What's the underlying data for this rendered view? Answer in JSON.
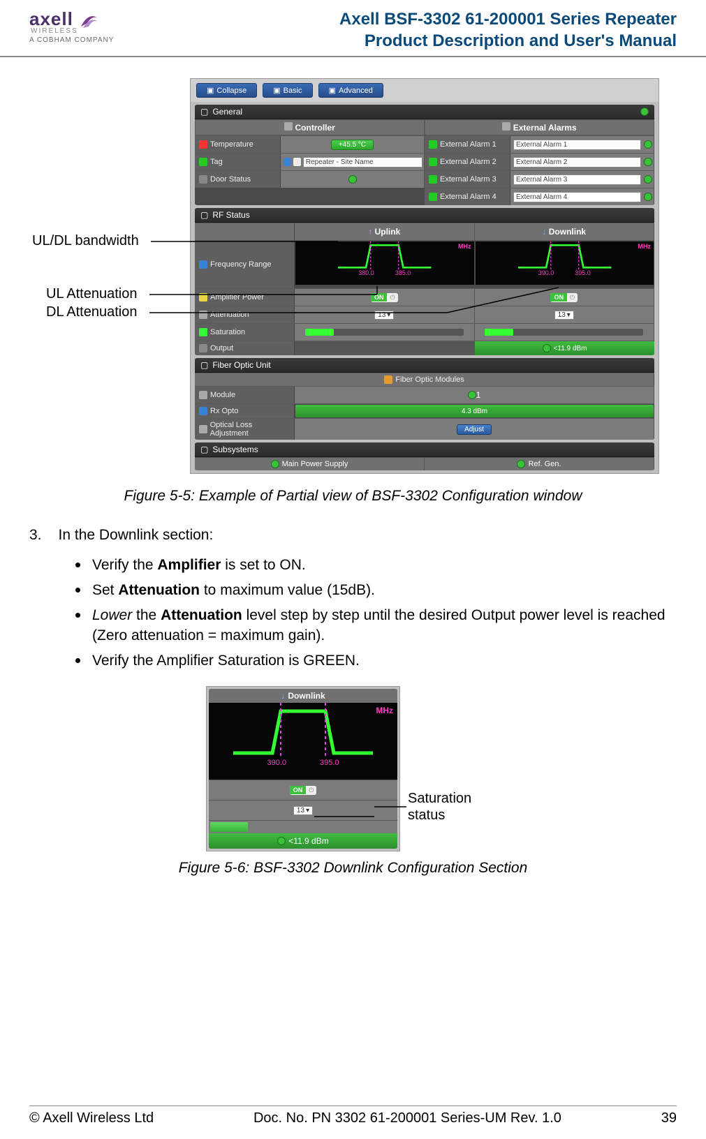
{
  "header": {
    "brand": "axell",
    "brand_sub": "WIRELESS",
    "cobham": "A COBHAM COMPANY",
    "title1": "Axell BSF-3302 61-200001 Series Repeater",
    "title2": "Product Description and User's Manual"
  },
  "toolbar": {
    "collapse": "Collapse",
    "basic": "Basic",
    "advanced": "Advanced"
  },
  "panels": {
    "general": {
      "title": "General",
      "controller": "Controller",
      "ext_alarms": "External Alarms",
      "temperature_label": "Temperature",
      "temperature_value": "+45.5 °C",
      "tag_label": "Tag",
      "tag_value": "Repeater - Site Name",
      "door_label": "Door Status",
      "ext1_label": "External Alarm 1",
      "ext1_value": "External Alarm 1",
      "ext2_label": "External Alarm 2",
      "ext2_value": "External Alarm 2",
      "ext3_label": "External Alarm 3",
      "ext3_value": "External Alarm 3",
      "ext4_label": "External Alarm 4",
      "ext4_value": "External Alarm 4"
    },
    "rf": {
      "title": "RF Status",
      "uplink": "Uplink",
      "downlink": "Downlink",
      "freq_range": "Frequency Range",
      "ul_lo": "380.0",
      "ul_hi": "385.0",
      "dl_lo": "390.0",
      "dl_hi": "395.0",
      "mhz": "MHz",
      "amp_power": "Amplifier Power",
      "attenuation": "Attenuation",
      "atten_val": "13",
      "saturation": "Saturation",
      "output": "Output",
      "output_val": "<11.9 dBm"
    },
    "fiber": {
      "title": "Fiber Optic Unit",
      "modules": "Fiber Optic Modules",
      "module_label": "Module",
      "module_val": "1",
      "rx_label": "Rx Opto",
      "rx_val": "4.3 dBm",
      "adj_label": "Optical Loss Adjustment",
      "adj_btn": "Adjust"
    },
    "sub": {
      "title": "Subsystems",
      "main_ps": "Main Power Supply",
      "ref_gen": "Ref. Gen."
    }
  },
  "callouts": {
    "bw": "UL/DL bandwidth",
    "ul_att": "UL Attenuation",
    "dl_att": "DL Attenuation",
    "sat": "Saturation status"
  },
  "captions": {
    "fig55": "Figure 5-5: Example of Partial view of BSF-3302 Configuration window",
    "fig56": "Figure 5-6: BSF-3302 Downlink Configuration Section"
  },
  "body": {
    "num": "3.",
    "lead": "In the Downlink section:",
    "b1_pre": "Verify the ",
    "b1_bold": "Amplifier",
    "b1_post": " is set to ON.",
    "b2_pre": "Set ",
    "b2_bold": "Attenuation",
    "b2_post": " to maximum value (15dB).",
    "b3_pre_i": "Lower",
    "b3_mid": " the ",
    "b3_bold": "Attenuation",
    "b3_post": " level step by step until the desired Output power level is reached (Zero attenuation = maximum gain).",
    "b4": "Verify the Amplifier Saturation is GREEN."
  },
  "dl_fig": {
    "head": "Downlink",
    "mhz": "MHz",
    "lo": "390.0",
    "hi": "395.0",
    "atten": "13",
    "out": "<11.9 dBm"
  },
  "footer": {
    "left": "© Axell Wireless Ltd",
    "center": "Doc. No. PN 3302 61-200001 Series-UM Rev. 1.0",
    "right": "39"
  }
}
